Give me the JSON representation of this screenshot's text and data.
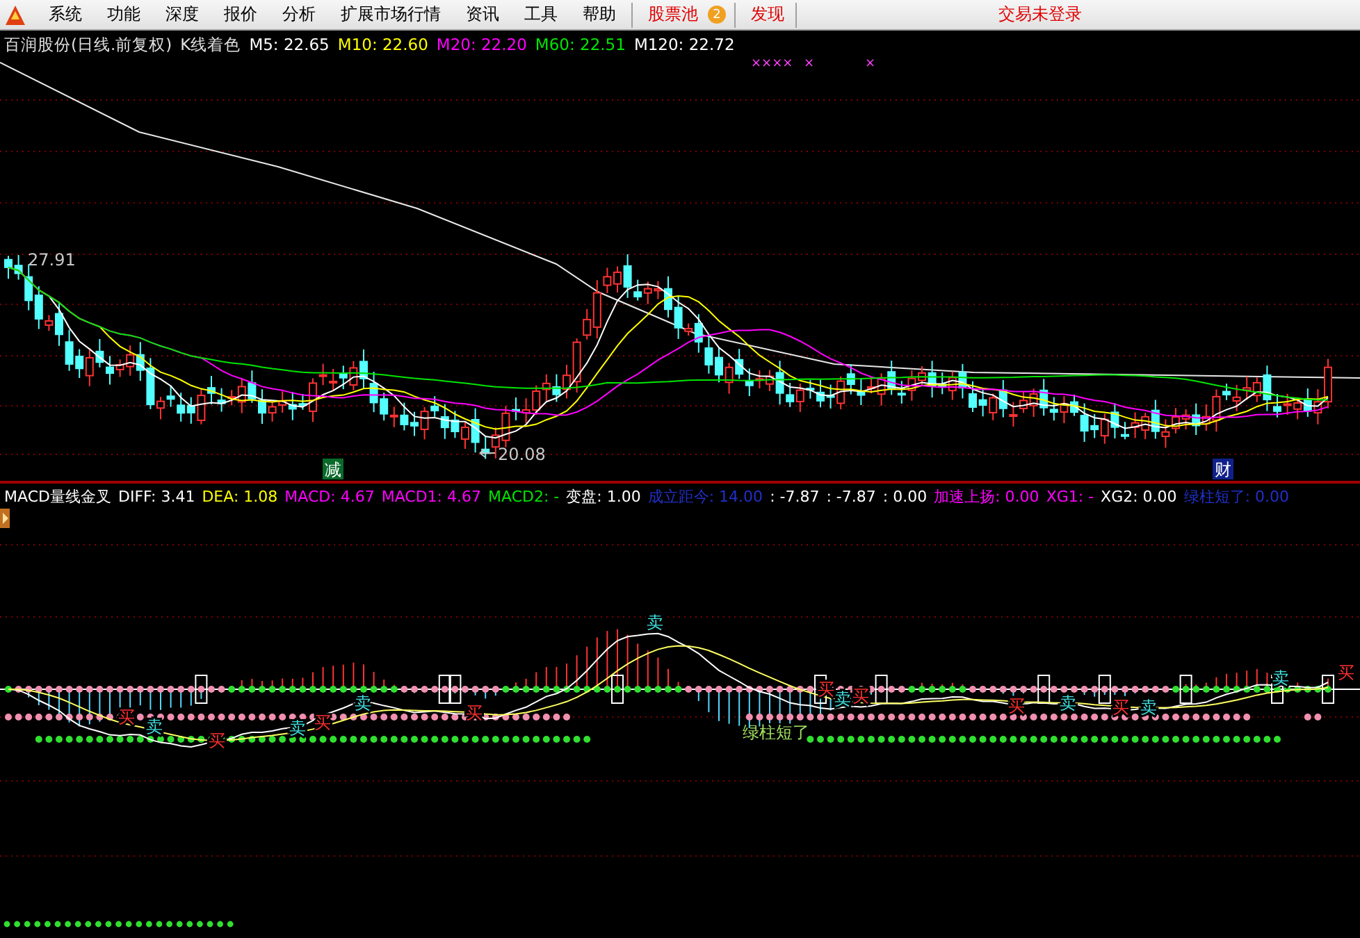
{
  "menu": {
    "items": [
      {
        "label": "系统",
        "kind": "normal"
      },
      {
        "label": "功能",
        "kind": "normal"
      },
      {
        "label": "深度",
        "kind": "normal"
      },
      {
        "label": "报价",
        "kind": "normal"
      },
      {
        "label": "分析",
        "kind": "normal"
      },
      {
        "label": "扩展市场行情",
        "kind": "normal"
      },
      {
        "label": "资讯",
        "kind": "normal"
      },
      {
        "label": "工具",
        "kind": "normal"
      },
      {
        "label": "帮助",
        "kind": "normal"
      },
      {
        "label": "股票池",
        "kind": "highlight",
        "badge": "2"
      },
      {
        "label": "发现",
        "kind": "highlight"
      }
    ],
    "login_status": "交易未登录"
  },
  "price_info": {
    "title": "百润股份(日线.前复权)",
    "mode": "K线着色",
    "averages": [
      {
        "text": "M5: 22.65",
        "color": "#ffffff"
      },
      {
        "text": "M10: 22.60",
        "color": "#ffff00"
      },
      {
        "text": "M20: 22.20",
        "color": "#ff00ff"
      },
      {
        "text": "M60: 22.51",
        "color": "#00e600"
      },
      {
        "text": "M120: 22.72",
        "color": "#ffffff"
      }
    ]
  },
  "price_chart": {
    "top_marks": [
      "××××",
      "×",
      "×"
    ],
    "high_label": "27.91",
    "low_label": "20.08",
    "events": [
      {
        "text": "减",
        "kind": "green"
      },
      {
        "text": "财",
        "kind": "blue"
      }
    ]
  },
  "indicator_info": [
    {
      "text": "MACD量线金叉",
      "color": "#ffffff"
    },
    {
      "text": "DIFF: 3.41",
      "color": "#ffffff"
    },
    {
      "text": "DEA: 1.08",
      "color": "#ffff00"
    },
    {
      "text": "MACD: 4.67",
      "color": "#ff00ff"
    },
    {
      "text": "MACD1: 4.67",
      "color": "#ff00ff"
    },
    {
      "text": "MACD2: -",
      "color": "#00e600"
    },
    {
      "text": "变盘: 1.00",
      "color": "#ffffff"
    },
    {
      "text": "成立距今: 14.00",
      "color": "#2030c8"
    },
    {
      "text": ": -7.87",
      "color": "#ffffff"
    },
    {
      "text": ": -7.87",
      "color": "#ffffff"
    },
    {
      "text": ": 0.00",
      "color": "#ffffff"
    },
    {
      "text": "加速上扬: 0.00",
      "color": "#ff00ff"
    },
    {
      "text": "XG1: -",
      "color": "#ff00ff"
    },
    {
      "text": "XG2: 0.00",
      "color": "#ffffff"
    },
    {
      "text": "绿柱短了: 0.00",
      "color": "#2030c8"
    }
  ],
  "indicator_chart": {
    "signals": [
      {
        "text": "买",
        "kind": "buy"
      },
      {
        "text": "卖",
        "kind": "sell"
      },
      {
        "text": "买",
        "kind": "buy"
      },
      {
        "text": "卖",
        "kind": "sell"
      },
      {
        "text": "买",
        "kind": "buy"
      },
      {
        "text": "卖",
        "kind": "sell"
      },
      {
        "text": "买",
        "kind": "buy"
      },
      {
        "text": "卖",
        "kind": "sell"
      },
      {
        "text": "买",
        "kind": "buy"
      },
      {
        "text": "卖",
        "kind": "sell"
      },
      {
        "text": "买",
        "kind": "buy"
      },
      {
        "text": "买",
        "kind": "buy"
      },
      {
        "text": "卖",
        "kind": "sell"
      },
      {
        "text": "买",
        "kind": "buy"
      },
      {
        "text": "卖",
        "kind": "sell"
      },
      {
        "text": "卖",
        "kind": "sell"
      },
      {
        "text": "买",
        "kind": "buy"
      }
    ],
    "note": "绿柱短了"
  }
}
